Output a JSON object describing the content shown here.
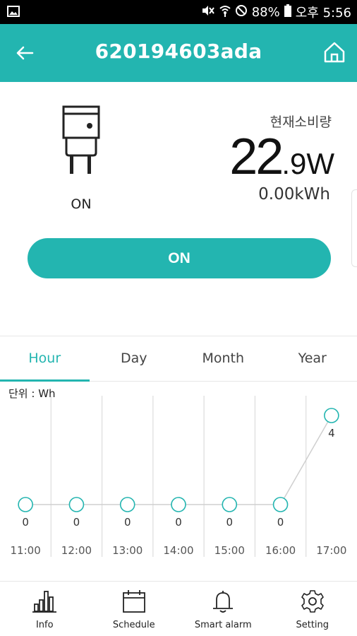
{
  "status_bar": {
    "battery": "88%",
    "time": "오후 5:56"
  },
  "app_bar": {
    "title": "620194603ada"
  },
  "device": {
    "state": "ON",
    "power_label": "현재소비량",
    "power_whole": "22",
    "power_rest": ".9W",
    "energy": "0.00kWh",
    "toggle_label": "ON"
  },
  "tabs": [
    {
      "label": "Hour"
    },
    {
      "label": "Day"
    },
    {
      "label": "Month"
    },
    {
      "label": "Year"
    }
  ],
  "active_tab": "Hour",
  "unit_label": "단위 : Wh",
  "chart_data": {
    "type": "line",
    "x": [
      "11:00",
      "12:00",
      "13:00",
      "14:00",
      "15:00",
      "16:00",
      "17:00"
    ],
    "values": [
      0,
      0,
      0,
      0,
      0,
      0,
      4
    ],
    "ylim": [
      0,
      4
    ],
    "ylabel": "단위 : Wh",
    "grid": true,
    "line_color": "#23b5b0"
  },
  "bottom_nav": [
    {
      "label": "Info",
      "icon": "bar-chart-icon"
    },
    {
      "label": "Schedule",
      "icon": "calendar-icon"
    },
    {
      "label": "Smart alarm",
      "icon": "bell-icon"
    },
    {
      "label": "Setting",
      "icon": "gear-icon"
    }
  ],
  "colors": {
    "accent": "#23b5b0"
  }
}
